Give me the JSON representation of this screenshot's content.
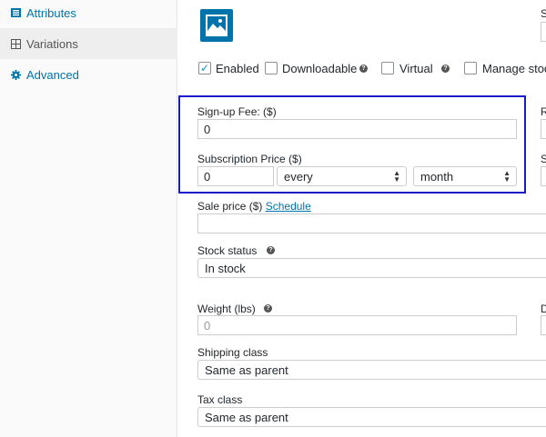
{
  "sidebar": {
    "items": [
      {
        "label": "Attributes",
        "icon": "list-icon"
      },
      {
        "label": "Variations",
        "icon": "grid-icon"
      },
      {
        "label": "Advanced",
        "icon": "gear-icon"
      }
    ]
  },
  "variation": {
    "checkboxes": [
      {
        "label": "Enabled",
        "checked": true
      },
      {
        "label": "Downloadable",
        "checked": false
      },
      {
        "label": "Virtual",
        "checked": false
      },
      {
        "label": "Manage stock",
        "checked": false
      }
    ],
    "signup_fee": {
      "label": "Sign-up Fee: ($)",
      "value": "0"
    },
    "subscription_price": {
      "label": "Subscription Price ($)",
      "value": "0",
      "interval": "every",
      "period": "month"
    },
    "sale_price": {
      "label": "Sale price ($)",
      "schedule_link": "Schedule",
      "value": ""
    },
    "stock_status": {
      "label": "Stock status",
      "value": "In stock"
    },
    "weight": {
      "label": "Weight (lbs)",
      "placeholder": "0"
    },
    "shipping_class": {
      "label": "Shipping class",
      "value": "Same as parent"
    },
    "tax_class": {
      "label": "Tax class",
      "value": "Same as parent"
    },
    "right_column_letters": [
      "S",
      "R",
      "S",
      "D"
    ]
  },
  "colors": {
    "accent": "#0073aa",
    "highlight": "#1a1acb"
  }
}
